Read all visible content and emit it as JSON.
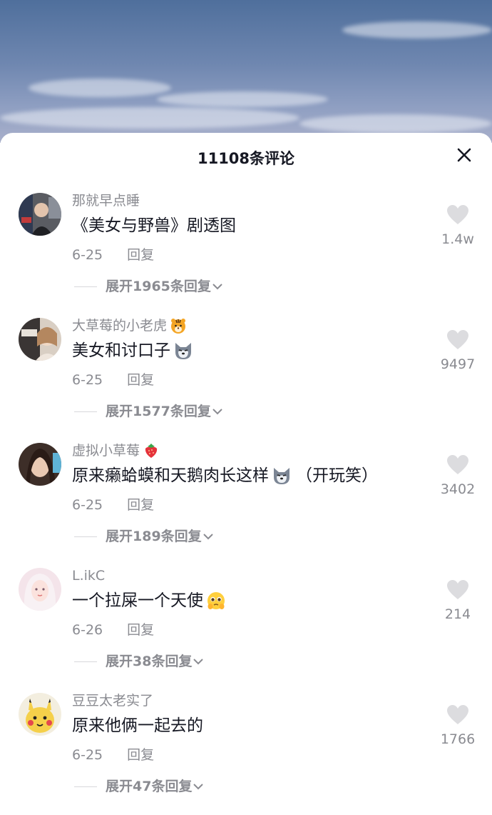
{
  "header": {
    "title": "11108条评论"
  },
  "comments": [
    {
      "username": "那就早点睡",
      "username_emoji": "",
      "text": "《美女与野兽》剧透图",
      "text_emoji": "",
      "text_suffix": "",
      "date": "6-25",
      "reply_label": "回复",
      "expand_label": "展开1965条回复",
      "likes": "1.4w",
      "avatar_color": "#6b6b70"
    },
    {
      "username": "大草莓的小老虎",
      "username_emoji": "tiger-emoji",
      "text": "美女和讨口子",
      "text_emoji": "wolf-emoji",
      "text_suffix": "",
      "date": "6-25",
      "reply_label": "回复",
      "expand_label": "展开1577条回复",
      "likes": "9497",
      "avatar_color": "#c9b9a8"
    },
    {
      "username": "虚拟小草莓",
      "username_emoji": "strawberry-emoji",
      "text": "原来癞蛤蟆和天鹅肉长这样",
      "text_emoji": "wolf-emoji",
      "text_suffix": "（开玩笑）",
      "date": "6-25",
      "reply_label": "回复",
      "expand_label": "展开189条回复",
      "likes": "3402",
      "avatar_color": "#8a6b5b"
    },
    {
      "username": "L.ikC",
      "username_emoji": "",
      "text": "一个拉屎一个天使",
      "text_emoji": "pleading-face-emoji",
      "text_suffix": "",
      "date": "6-26",
      "reply_label": "回复",
      "expand_label": "展开38条回复",
      "likes": "214",
      "avatar_color": "#f1d8e0"
    },
    {
      "username": "豆豆太老实了",
      "username_emoji": "",
      "text": "原来他俩一起去的",
      "text_emoji": "",
      "text_suffix": "",
      "date": "6-25",
      "reply_label": "回复",
      "expand_label": "展开47条回复",
      "likes": "1766",
      "avatar_color": "#f5d04a"
    }
  ],
  "colors": {
    "text": "#161823",
    "muted": "#8a8b91",
    "heart": "#dcdcdf"
  }
}
